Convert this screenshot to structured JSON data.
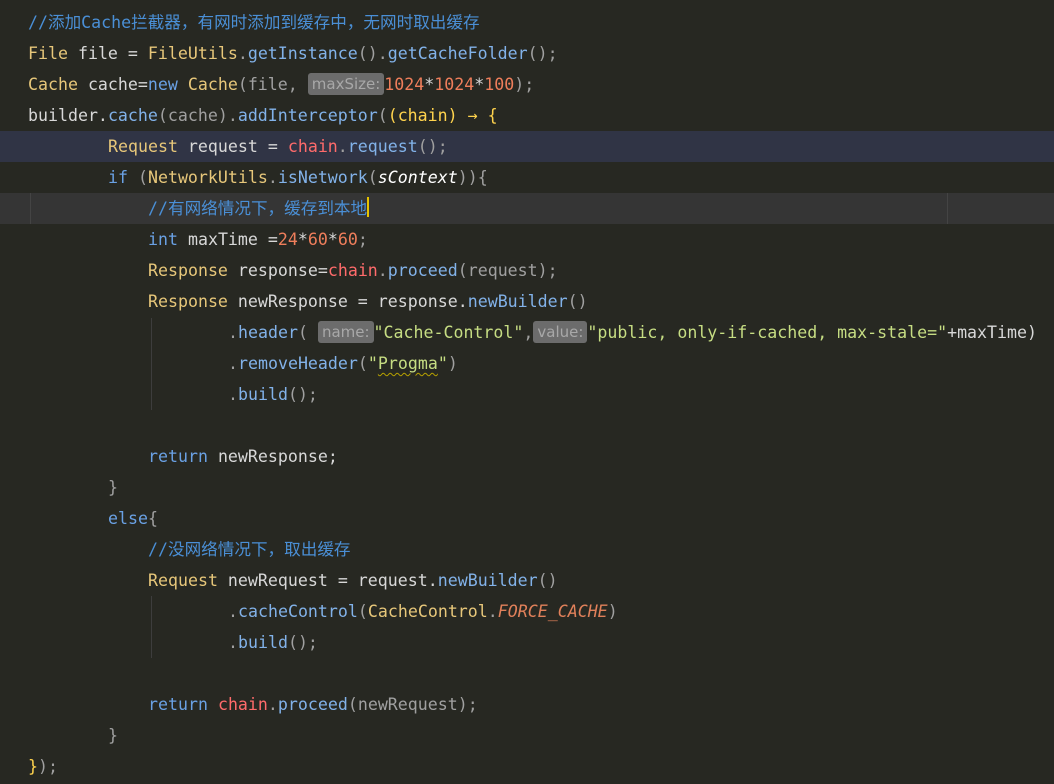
{
  "editor": {
    "colors": {
      "background": "#272822",
      "comment": "#4a8fd6",
      "type": "#e7c77a",
      "keyword": "#6aa1e4",
      "string": "#c6dd83",
      "number": "#ef7e5b",
      "caret": "#e6c300"
    },
    "code": {
      "l1_comment": "//添加Cache拦截器，有网时添加到缓存中，无网时取出缓存",
      "l2": {
        "type": "File",
        "var": " file = ",
        "cls": "FileUtils",
        "dot1": ".",
        "m1": "getInstance",
        "p1": "().",
        "m2": "getCacheFolder",
        "end": "();"
      },
      "l3": {
        "type": "Cache",
        "var": " cache=",
        "kw": "new",
        "sp": " ",
        "cls": "Cache",
        "open": "(file, ",
        "hint": "maxSize:",
        "n1": "1024",
        "op1": "*",
        "n2": "1024",
        "op2": "*",
        "n3": "100",
        "end": ");"
      },
      "l4": {
        "a": "builder.",
        "m1": "cache",
        "b": "(cache).",
        "m2": "addInterceptor",
        "c": "(",
        "lam": "(chain)",
        "arrow": " → ",
        "brace": "{"
      },
      "l5": {
        "type": "Request",
        "var": " request = ",
        "chain": "chain",
        "dot": ".",
        "m": "request",
        "end": "();"
      },
      "l6": {
        "kw": "if",
        "a": " (",
        "cls": "NetworkUtils",
        "dot": ".",
        "m": "isNetwork",
        "b": "(",
        "it": "sContext",
        "end": ")){"
      },
      "l7_comment": "//有网络情况下，缓存到本地",
      "l8": {
        "kw": "int",
        "var": " maxTime =",
        "n1": "24",
        "op1": "*",
        "n2": "60",
        "op2": "*",
        "n3": "60",
        "end": ";"
      },
      "l9": {
        "type": "Response",
        "var": " response=",
        "chain": "chain",
        "dot": ".",
        "m": "proceed",
        "end": "(request);"
      },
      "l10": {
        "type": "Response",
        "var": " newResponse = response.",
        "m": "newBuilder",
        "end": "()"
      },
      "l11": {
        "dot": ".",
        "m": "header",
        "open": "( ",
        "hint1": "name:",
        "s1": "\"Cache-Control\"",
        "comma": ",",
        "hint2": "value:",
        "s2": "\"public, only-if-cached, max-stale=\"",
        "end": "+maxTime)"
      },
      "l12": {
        "dot": ".",
        "m": "removeHeader",
        "open": "(",
        "q1": "\"",
        "word": "Progma",
        "q2": "\"",
        "end": ")"
      },
      "l13": {
        "dot": ".",
        "m": "build",
        "end": "();"
      },
      "l15": {
        "kw": "return",
        "rest": " newResponse;"
      },
      "l16": "}",
      "l17": {
        "kw": "else",
        "rest": "{"
      },
      "l18_comment": "//没网络情况下，取出缓存",
      "l19": {
        "type": "Request",
        "var": " newRequest = request.",
        "m": "newBuilder",
        "end": "()"
      },
      "l20": {
        "dot": ".",
        "m": "cacheControl",
        "open": "(",
        "cls": "CacheControl",
        "dot2": ".",
        "cnst": "FORCE_CACHE",
        "end": ")"
      },
      "l21": {
        "dot": ".",
        "m": "build",
        "end": "();"
      },
      "l23": {
        "kw": "return",
        "sp": " ",
        "chain": "chain",
        "dot": ".",
        "m": "proceed",
        "end": "(newRequest);"
      },
      "l24": "}",
      "l25": {
        "brace": "}",
        "end": ");"
      }
    }
  }
}
